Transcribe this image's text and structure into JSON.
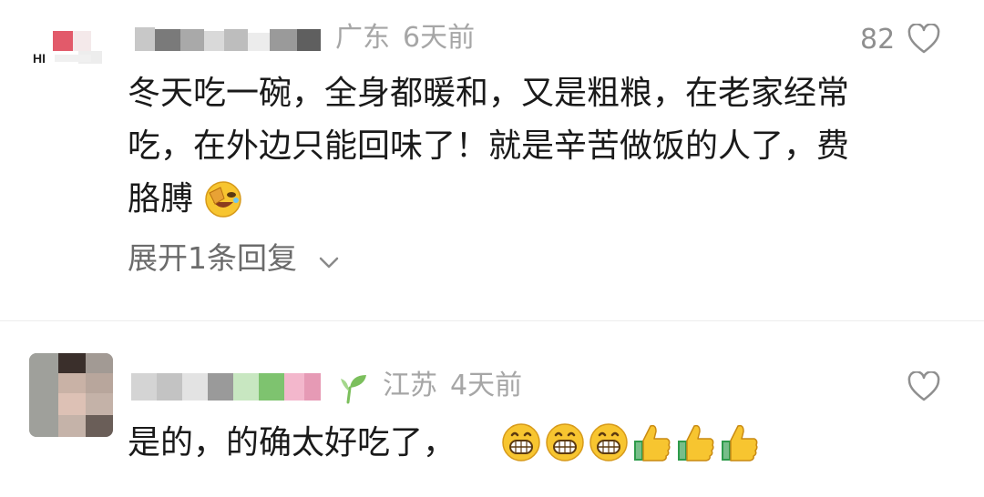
{
  "comments": [
    {
      "avatar_text": "HI",
      "location": "广东",
      "time": "6天前",
      "like_count": "82",
      "text_lines": [
        "冬天吃一碗，全身都暖和，又是粗粮，在老家经常",
        "吃，在外边只能回味了！就是辛苦做饭的人了，费",
        "胳膊"
      ],
      "expand_replies": "展开1条回复",
      "emoji": [
        "facepalm-laugh-emoji"
      ]
    },
    {
      "location": "江苏",
      "time": "4天前",
      "text": "是的，的确太好吃了，",
      "emoji": [
        "grin-emoji",
        "grin-emoji",
        "grin-emoji",
        "thumbs-up-emoji",
        "thumbs-up-emoji",
        "thumbs-up-emoji"
      ]
    }
  ],
  "colors": {
    "text": "#1a1a1a",
    "meta": "#a6a6a6",
    "divider": "#ededed",
    "emoji_yellow": "#f7c530"
  }
}
